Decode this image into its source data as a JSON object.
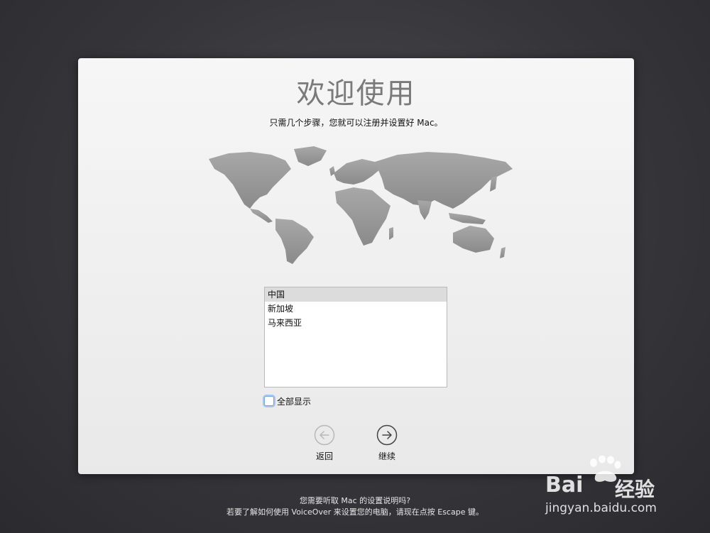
{
  "window": {
    "title": "欢迎使用",
    "subtitle": "只需几个步骤，您就可以注册并设置好 Mac。"
  },
  "country_list": {
    "items": [
      {
        "label": "中国",
        "selected": true
      },
      {
        "label": "新加坡",
        "selected": false
      },
      {
        "label": "马来西亚",
        "selected": false
      }
    ]
  },
  "show_all": {
    "label": "全部显示",
    "checked": false
  },
  "nav": {
    "back_label": "返回",
    "next_label": "继续"
  },
  "footer": {
    "line1": "您需要听取 Mac 的设置说明吗?",
    "line2": "若要了解如何使用 VoiceOver 来设置您的电脑，请现在点按 Escape 键。"
  },
  "watermark": {
    "brand": "Bai",
    "brand_suffix": "经验",
    "url": "jingyan.baidu.com"
  },
  "colors": {
    "panel_bg": "#efefef",
    "map_gray": "#9a9a9a",
    "title_gray": "#7a7a7a",
    "focus_ring": "#5a96f0"
  }
}
